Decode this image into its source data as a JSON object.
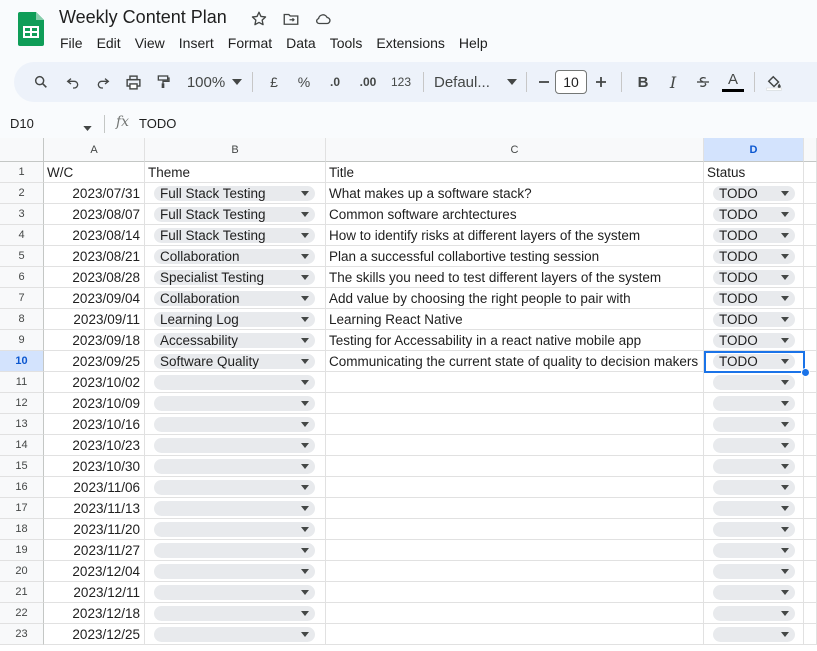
{
  "doc": {
    "title": "Weekly Content Plan"
  },
  "menu": [
    "File",
    "Edit",
    "View",
    "Insert",
    "Format",
    "Data",
    "Tools",
    "Extensions",
    "Help"
  ],
  "toolbar": {
    "zoom": "100%",
    "currency": "£",
    "percent": "%",
    "dec_decrease": ".0",
    "dec_increase": ".00",
    "number_format": "123",
    "font": "Defaul...",
    "font_size": "10",
    "bold": "B",
    "italic": "I",
    "text_color": "A"
  },
  "formula_bar": {
    "cell_ref": "D10",
    "fx": "fx",
    "value": "TODO"
  },
  "columns": [
    "A",
    "B",
    "C",
    "D"
  ],
  "selected": {
    "row": 10,
    "col": "D"
  },
  "header_row": {
    "a": "W/C",
    "b": "Theme",
    "c": "Title",
    "d": "Status"
  },
  "rows": [
    {
      "num": "2",
      "a": "2023/07/31",
      "b": "Full Stack Testing",
      "c": "What makes up a software stack?",
      "d": "TODO"
    },
    {
      "num": "3",
      "a": "2023/08/07",
      "b": "Full Stack Testing",
      "c": "Common software archtectures",
      "d": "TODO"
    },
    {
      "num": "4",
      "a": "2023/08/14",
      "b": "Full Stack Testing",
      "c": "How to identify risks at different layers of the system",
      "d": "TODO"
    },
    {
      "num": "5",
      "a": "2023/08/21",
      "b": "Collaboration",
      "c": "Plan a successful collabortive testing session",
      "d": "TODO"
    },
    {
      "num": "6",
      "a": "2023/08/28",
      "b": "Specialist Testing",
      "c": "The skills you need to test different layers of the system",
      "d": "TODO"
    },
    {
      "num": "7",
      "a": "2023/09/04",
      "b": "Collaboration",
      "c": "Add value by choosing the right people to pair with",
      "d": "TODO"
    },
    {
      "num": "8",
      "a": "2023/09/11",
      "b": "Learning Log",
      "c": "Learning React Native",
      "d": "TODO"
    },
    {
      "num": "9",
      "a": "2023/09/18",
      "b": "Accessability",
      "c": "Testing for Accessability in a react native mobile app",
      "d": "TODO"
    },
    {
      "num": "10",
      "a": "2023/09/25",
      "b": "Software Quality",
      "c": "Communicating the current state of quality to decision makers",
      "d": "TODO"
    },
    {
      "num": "11",
      "a": "2023/10/02",
      "b": "",
      "c": "",
      "d": ""
    },
    {
      "num": "12",
      "a": "2023/10/09",
      "b": "",
      "c": "",
      "d": ""
    },
    {
      "num": "13",
      "a": "2023/10/16",
      "b": "",
      "c": "",
      "d": ""
    },
    {
      "num": "14",
      "a": "2023/10/23",
      "b": "",
      "c": "",
      "d": ""
    },
    {
      "num": "15",
      "a": "2023/10/30",
      "b": "",
      "c": "",
      "d": ""
    },
    {
      "num": "16",
      "a": "2023/11/06",
      "b": "",
      "c": "",
      "d": ""
    },
    {
      "num": "17",
      "a": "2023/11/13",
      "b": "",
      "c": "",
      "d": ""
    },
    {
      "num": "18",
      "a": "2023/11/20",
      "b": "",
      "c": "",
      "d": ""
    },
    {
      "num": "19",
      "a": "2023/11/27",
      "b": "",
      "c": "",
      "d": ""
    },
    {
      "num": "20",
      "a": "2023/12/04",
      "b": "",
      "c": "",
      "d": ""
    },
    {
      "num": "21",
      "a": "2023/12/11",
      "b": "",
      "c": "",
      "d": ""
    },
    {
      "num": "22",
      "a": "2023/12/18",
      "b": "",
      "c": "",
      "d": ""
    },
    {
      "num": "23",
      "a": "2023/12/25",
      "b": "",
      "c": "",
      "d": ""
    }
  ]
}
